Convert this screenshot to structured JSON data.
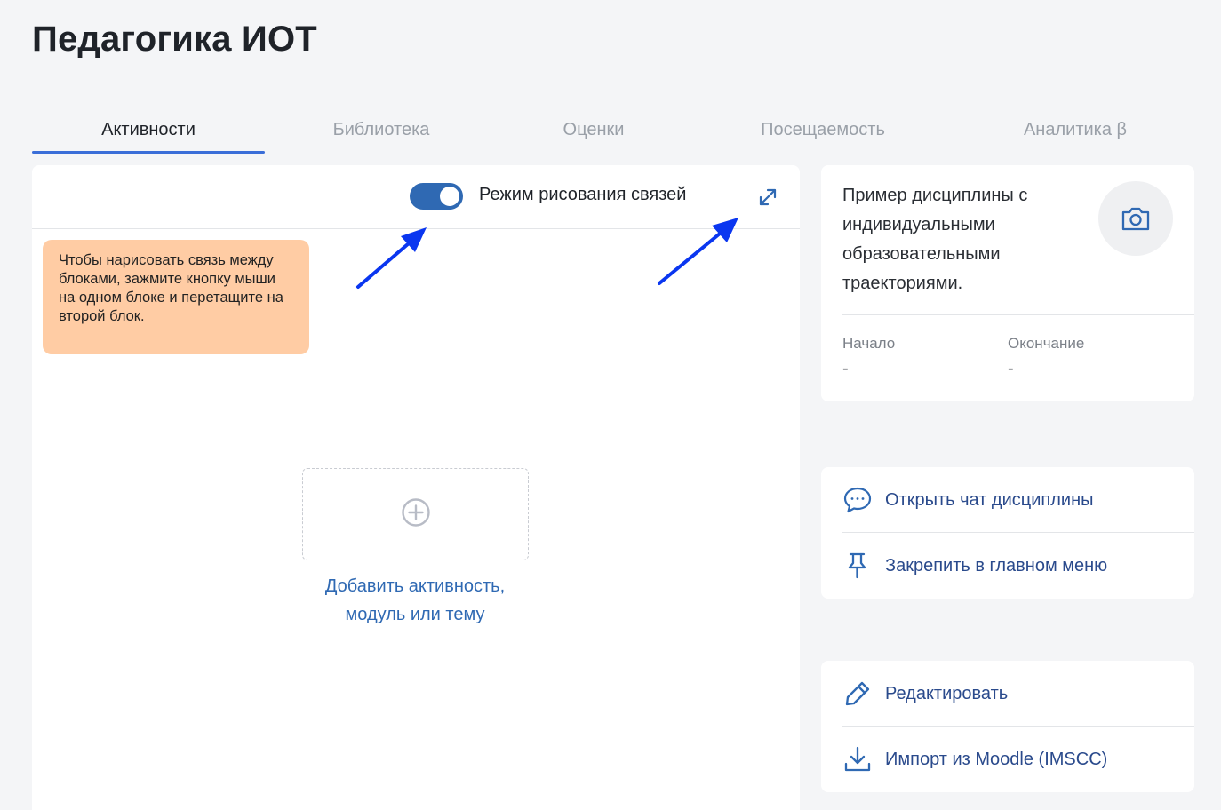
{
  "page": {
    "title": "Педагогика ИОТ"
  },
  "tabs": [
    {
      "label": "Активности",
      "active": true
    },
    {
      "label": "Библиотека",
      "active": false
    },
    {
      "label": "Оценки",
      "active": false
    },
    {
      "label": "Посещаемость",
      "active": false
    },
    {
      "label": "Аналитика β",
      "active": false
    }
  ],
  "canvas": {
    "draw_mode_label": "Режим рисования связей",
    "draw_mode_on": true,
    "hint": "Чтобы нарисовать связь между блоками, зажмите кнопку мыши на одном блоке и перетащите на второй блок.",
    "add_label_line1": "Добавить активность,",
    "add_label_line2": "модуль или тему"
  },
  "course": {
    "description": "Пример дисциплины с индивидуальными образовательными траекториями.",
    "start_label": "Начало",
    "start_value": "-",
    "end_label": "Окончание",
    "end_value": "-"
  },
  "actions": {
    "open_chat": "Открыть чат дисциплины",
    "pin_menu": "Закрепить в главном меню",
    "edit": "Редактировать",
    "import_moodle": "Импорт из Moodle (IMSCC)"
  },
  "icons": {
    "expand": "expand-icon",
    "camera": "camera-icon",
    "chat": "chat-icon",
    "pin": "pin-icon",
    "edit": "pencil-icon",
    "import": "download-icon",
    "add": "plus-circle-icon"
  },
  "colors": {
    "accent": "#2f69b3",
    "tab_underline": "#3a6ed8",
    "hint_bg": "#ffcca4",
    "annotation_arrow": "#0a36f0",
    "action_text": "#2a4a8c"
  }
}
